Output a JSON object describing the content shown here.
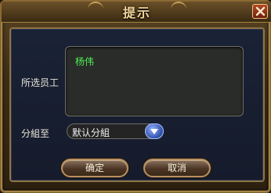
{
  "dialog": {
    "title": "提示",
    "close_icon": "close-icon"
  },
  "form": {
    "selected_label": "所选员工",
    "selected_value": "杨伟",
    "group_label": "分組至",
    "group_select_value": "默认分組",
    "dropdown_icon": "chevron-down-icon"
  },
  "buttons": {
    "confirm_label": "确定",
    "cancel_label": "取消"
  },
  "colors": {
    "title_text": "#f2d79a",
    "name_text": "#4ff04f",
    "panel_bg": "#1a2236",
    "frame": "#8a6a34"
  }
}
